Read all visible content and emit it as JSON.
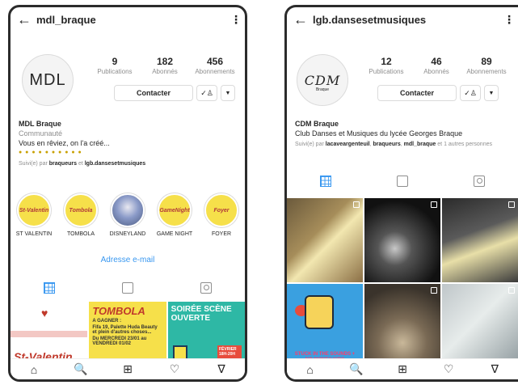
{
  "left_profile": {
    "username": "mdl_braque",
    "avatar_text": "MDL",
    "stats": [
      {
        "num": "9",
        "label": "Publications"
      },
      {
        "num": "182",
        "label": "Abonnés"
      },
      {
        "num": "456",
        "label": "Abonnements"
      }
    ],
    "contact_label": "Contacter",
    "bio": {
      "name": "MDL Braque",
      "category": "Communauté",
      "line": "Vous en rêviez, on l'a créé...",
      "emojis": "● ● ● ● ● ● ● ● ● ●",
      "followed_prefix": "Suivi(e) par",
      "followed_a": "braqueurs",
      "followed_and": "et",
      "followed_b": "lgb.dansesetmusiques"
    },
    "highlights": [
      {
        "label": "ST VALENTIN",
        "cover": "St-Valentin",
        "color": "#f6e04a"
      },
      {
        "label": "TOMBOLA",
        "cover": "Tombola",
        "color": "#f6e04a"
      },
      {
        "label": "DISNEYLAND",
        "cover": "",
        "color": "#7a8fc0"
      },
      {
        "label": "GAME NIGHT",
        "cover": "GameNight",
        "color": "#f6e04a"
      },
      {
        "label": "FOYER",
        "cover": "Foyer",
        "color": "#f6e04a"
      }
    ],
    "email_link": "Adresse e-mail",
    "posts": {
      "valentin_title": "St-Valentin",
      "tombola_head": "TOMBOLA",
      "tombola_gagner": "A GAGNER :",
      "tombola_text": "Fifa 19, Palette Huda Beauty et plein d'autres choses...",
      "tombola_dates": "Du MERCREDI 23/01 au VENDREDI 01/02",
      "soiree_title": "SOIRÉE SCÈNE OUVERTE",
      "soiree_date": "FÉVRIER 18H-20H"
    }
  },
  "right_profile": {
    "username": "lgb.dansesetmusiques",
    "avatar_text": "CDM",
    "avatar_sub": "Braque",
    "stats": [
      {
        "num": "12",
        "label": "Publications"
      },
      {
        "num": "46",
        "label": "Abonnés"
      },
      {
        "num": "89",
        "label": "Abonnements"
      }
    ],
    "contact_label": "Contacter",
    "bio": {
      "name": "CDM Braque",
      "line": "Club Danses et Musiques du lycée Georges Braque",
      "followed_prefix": "Suivi(e) par",
      "followed_a": "lacaveargenteuil",
      "followed_b": "braqueurs",
      "followed_c": "mdl_braque",
      "followed_more": "et 1 autres personnes"
    },
    "poster_text": "STUCK IN THE SOUNDS + NO MONEY KIDS"
  },
  "icons": {
    "back": "←",
    "more": "⋮",
    "caret": "▼",
    "follow": "✓♙",
    "home": "⌂",
    "search": "🔍",
    "add": "⊞",
    "heart": "♡",
    "send": "∇"
  }
}
